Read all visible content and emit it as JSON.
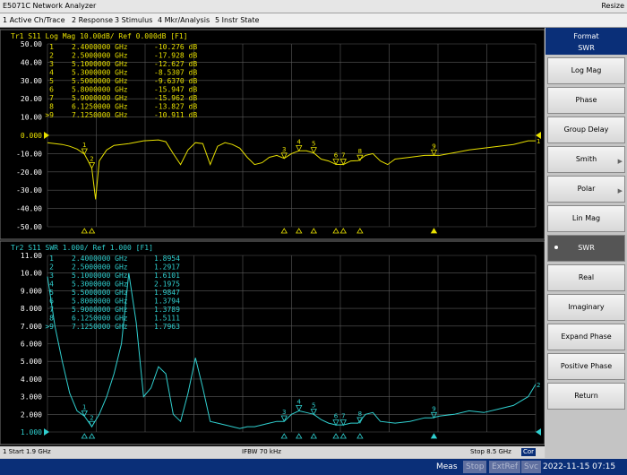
{
  "window": {
    "title": "E5071C Network Analyzer",
    "resize_label": "Resize"
  },
  "menu": [
    {
      "label": "1 Active Ch/Trace"
    },
    {
      "label": "2 Response"
    },
    {
      "label": "3 Stimulus"
    },
    {
      "label": "4 Mkr/Analysis"
    },
    {
      "label": "5 Instr State"
    }
  ],
  "softkeys": {
    "title": "Format",
    "current": "SWR",
    "items": [
      {
        "label": "Log Mag",
        "arrow": ""
      },
      {
        "label": "Phase",
        "arrow": ""
      },
      {
        "label": "Group Delay",
        "arrow": ""
      },
      {
        "label": "Smith",
        "arrow": "▶"
      },
      {
        "label": "Polar",
        "arrow": "▶"
      },
      {
        "label": "Lin Mag",
        "arrow": ""
      },
      {
        "label": "SWR",
        "arrow": ""
      },
      {
        "label": "Real",
        "arrow": ""
      },
      {
        "label": "Imaginary",
        "arrow": ""
      },
      {
        "label": "Expand Phase",
        "arrow": ""
      },
      {
        "label": "Positive Phase",
        "arrow": ""
      },
      {
        "label": "Return",
        "arrow": ""
      }
    ]
  },
  "colors": {
    "trace1": "#e8e000",
    "trace2": "#30d0d0",
    "grid": "#5a5a5a",
    "bg": "#000000"
  },
  "chart_data": [
    {
      "type": "line",
      "trace_header": "Tr1 S11 Log Mag 10.00dB/ Ref 0.000dB [F1]",
      "reference_label": "0.000",
      "x_range": [
        1.9,
        8.5
      ],
      "y_range": [
        -50,
        50
      ],
      "yticks": [
        "50.00",
        "40.00",
        "30.00",
        "20.00",
        "10.00",
        "0.000",
        "-10.00",
        "-20.00",
        "-30.00",
        "-40.00",
        "-50.00"
      ],
      "marker_table": [
        {
          "id": "1",
          "freq": "2.4000000 GHz",
          "value": "-10.276 dB"
        },
        {
          "id": "2",
          "freq": "2.5000000 GHz",
          "value": "-17.928 dB"
        },
        {
          "id": "3",
          "freq": "5.1000000 GHz",
          "value": "-12.627 dB"
        },
        {
          "id": "4",
          "freq": "5.3000000 GHz",
          "value": "-8.5307 dB"
        },
        {
          "id": "5",
          "freq": "5.5000000 GHz",
          "value": "-9.6370 dB"
        },
        {
          "id": "6",
          "freq": "5.8000000 GHz",
          "value": "-15.947 dB"
        },
        {
          "id": "7",
          "freq": "5.9000000 GHz",
          "value": "-15.962 dB"
        },
        {
          "id": "8",
          "freq": "6.1250000 GHz",
          "value": "-13.827 dB"
        },
        {
          "id": ">9",
          "freq": "7.1250000 GHz",
          "value": "-10.911 dB"
        }
      ],
      "x": [
        1.9,
        2.0,
        2.1,
        2.2,
        2.3,
        2.4,
        2.45,
        2.5,
        2.55,
        2.6,
        2.7,
        2.8,
        2.9,
        3.0,
        3.2,
        3.4,
        3.5,
        3.6,
        3.7,
        3.8,
        3.9,
        4.0,
        4.1,
        4.2,
        4.3,
        4.4,
        4.5,
        4.6,
        4.7,
        4.8,
        4.9,
        5.0,
        5.1,
        5.2,
        5.3,
        5.4,
        5.5,
        5.6,
        5.7,
        5.8,
        5.9,
        6.0,
        6.1,
        6.2,
        6.3,
        6.4,
        6.5,
        6.6,
        6.8,
        7.0,
        7.1,
        7.2,
        7.4,
        7.6,
        7.8,
        8.0,
        8.2,
        8.4,
        8.5
      ],
      "y": [
        -4,
        -4.5,
        -5,
        -6,
        -7.5,
        -10.3,
        -14,
        -18,
        -35,
        -14,
        -8,
        -5.5,
        -5,
        -4.5,
        -3,
        -2.5,
        -3.5,
        -10,
        -16,
        -8,
        -4,
        -4.5,
        -16,
        -6,
        -4,
        -5,
        -7,
        -12,
        -16,
        -15,
        -12,
        -11,
        -12.6,
        -10,
        -8.5,
        -8.5,
        -9.6,
        -13,
        -14,
        -15.9,
        -16,
        -14,
        -13.8,
        -11,
        -10,
        -14,
        -16,
        -13,
        -12,
        -11,
        -10.9,
        -11,
        -9.5,
        -8,
        -7,
        -6,
        -5,
        -3,
        -3
      ],
      "markers": [
        {
          "label": "1",
          "x": 2.4,
          "y": -10.276
        },
        {
          "label": "2",
          "x": 2.5,
          "y": -17.928
        },
        {
          "label": "3",
          "x": 5.1,
          "y": -12.627
        },
        {
          "label": "4",
          "x": 5.3,
          "y": -8.5307
        },
        {
          "label": "5",
          "x": 5.5,
          "y": -9.637
        },
        {
          "label": "6",
          "x": 5.8,
          "y": -15.947
        },
        {
          "label": "7",
          "x": 5.9,
          "y": -15.962
        },
        {
          "label": "8",
          "x": 6.125,
          "y": -13.827
        },
        {
          "label": "9",
          "x": 7.125,
          "y": -10.911
        }
      ],
      "end_label": "1"
    },
    {
      "type": "line",
      "trace_header": "Tr2 S11 SWR 1.000/ Ref 1.000 [F1]",
      "reference_label": "1.000",
      "x_range": [
        1.9,
        8.5
      ],
      "y_range": [
        1,
        11
      ],
      "yticks": [
        "11.00",
        "10.00",
        "9.000",
        "8.000",
        "7.000",
        "6.000",
        "5.000",
        "4.000",
        "3.000",
        "2.000",
        "1.000"
      ],
      "marker_table": [
        {
          "id": "1",
          "freq": "2.4000000 GHz",
          "value": "1.8954"
        },
        {
          "id": "2",
          "freq": "2.5000000 GHz",
          "value": "1.2917"
        },
        {
          "id": "3",
          "freq": "5.1000000 GHz",
          "value": "1.6101"
        },
        {
          "id": "4",
          "freq": "5.3000000 GHz",
          "value": "2.1975"
        },
        {
          "id": "5",
          "freq": "5.5000000 GHz",
          "value": "1.9847"
        },
        {
          "id": "6",
          "freq": "5.8000000 GHz",
          "value": "1.3794"
        },
        {
          "id": "7",
          "freq": "5.9000000 GHz",
          "value": "1.3789"
        },
        {
          "id": "8",
          "freq": "6.1250000 GHz",
          "value": "1.5111"
        },
        {
          "id": ">9",
          "freq": "7.1250000 GHz",
          "value": "1.7963"
        }
      ],
      "x": [
        1.9,
        2.0,
        2.1,
        2.2,
        2.3,
        2.4,
        2.45,
        2.5,
        2.6,
        2.7,
        2.8,
        2.9,
        3.0,
        3.1,
        3.2,
        3.3,
        3.4,
        3.5,
        3.6,
        3.7,
        3.8,
        3.9,
        4.0,
        4.1,
        4.2,
        4.3,
        4.4,
        4.5,
        4.6,
        4.7,
        4.8,
        4.9,
        5.0,
        5.1,
        5.2,
        5.3,
        5.4,
        5.5,
        5.6,
        5.7,
        5.8,
        5.9,
        6.0,
        6.1,
        6.2,
        6.3,
        6.4,
        6.6,
        6.8,
        7.0,
        7.1,
        7.2,
        7.4,
        7.6,
        7.8,
        8.0,
        8.2,
        8.4,
        8.5
      ],
      "y": [
        9.8,
        7,
        5,
        3.2,
        2.2,
        1.9,
        1.6,
        1.3,
        2,
        3,
        4.3,
        6,
        10,
        7.2,
        3,
        3.5,
        4.7,
        4.3,
        2,
        1.6,
        3.2,
        5.2,
        3.5,
        1.6,
        1.5,
        1.4,
        1.3,
        1.2,
        1.3,
        1.3,
        1.4,
        1.5,
        1.6,
        1.6,
        2,
        2.2,
        2.1,
        2,
        1.7,
        1.5,
        1.4,
        1.4,
        1.5,
        1.5,
        2,
        2.1,
        1.6,
        1.5,
        1.6,
        1.8,
        1.8,
        1.9,
        2,
        2.2,
        2.1,
        2.3,
        2.5,
        3,
        3.7
      ],
      "markers": [
        {
          "label": "1",
          "x": 2.4,
          "y": 1.8954
        },
        {
          "label": "2",
          "x": 2.5,
          "y": 1.2917
        },
        {
          "label": "3",
          "x": 5.1,
          "y": 1.6101
        },
        {
          "label": "4",
          "x": 5.3,
          "y": 2.1975
        },
        {
          "label": "5",
          "x": 5.5,
          "y": 1.9847
        },
        {
          "label": "6",
          "x": 5.8,
          "y": 1.3794
        },
        {
          "label": "7",
          "x": 5.9,
          "y": 1.3789
        },
        {
          "label": "8",
          "x": 6.125,
          "y": 1.5111
        },
        {
          "label": "9",
          "x": 7.125,
          "y": 1.7963
        }
      ],
      "end_label": "2"
    }
  ],
  "status": {
    "start": "1  Start 1.9 GHz",
    "ifbw": "IFBW 70 kHz",
    "stop": "Stop 8.5 GHz",
    "cor": "Cor"
  },
  "bottom": {
    "meas": "Meas",
    "stop": "Stop",
    "extref": "ExtRef",
    "svc": "Svc",
    "datetime": "2022-11-15 07:15"
  }
}
